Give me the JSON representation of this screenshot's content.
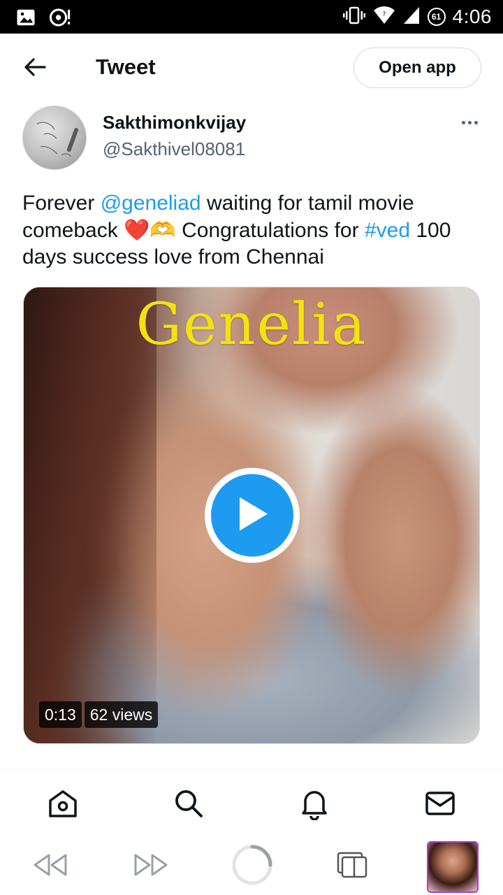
{
  "status_bar": {
    "time": "4:06",
    "battery": "61"
  },
  "header": {
    "title": "Tweet",
    "open_app_label": "Open app"
  },
  "tweet": {
    "display_name": "Sakthimonkvijay",
    "handle": "@Sakthivel08081",
    "text_parts": {
      "p1": "Forever ",
      "mention": "@geneliad",
      "p2": " waiting for tamil movie comeback ",
      "emoji": "❤️🫶",
      "p3": " Congratulations for ",
      "hashtag": "#ved",
      "p4": " 100 days success love from Chennai"
    },
    "media": {
      "title": "Genelia",
      "duration": "0:13",
      "views": "62 views"
    }
  },
  "icons": {
    "back": "arrow-left-icon",
    "more": "more-horizontal-icon",
    "play": "play-icon",
    "tabs": [
      "home-icon",
      "search-icon",
      "notifications-icon",
      "messages-icon"
    ],
    "browser": [
      "rewind-icon",
      "fast-forward-icon",
      "loading-icon",
      "tabs-icon"
    ]
  },
  "colors": {
    "accent": "#1d9bf0",
    "text": "#0f1419",
    "secondary": "#536471",
    "media_title": "#f4e20f"
  }
}
